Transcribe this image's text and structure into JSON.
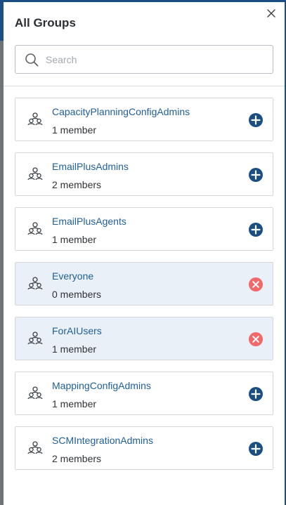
{
  "panel": {
    "title": "All Groups",
    "close_icon": "close-icon"
  },
  "search": {
    "placeholder": "Search",
    "value": "",
    "icon": "search-icon"
  },
  "colors": {
    "link": "#1f5e99",
    "add_button": "#1b4f83",
    "remove_button": "#f06a6a",
    "selected_row_bg": "#e9f0f7"
  },
  "groups": [
    {
      "name": "CapacityPlanningConfigAdmins",
      "members": "1 member",
      "selected": false,
      "action": "add"
    },
    {
      "name": "EmailPlusAdmins",
      "members": "2 members",
      "selected": false,
      "action": "add"
    },
    {
      "name": "EmailPlusAgents",
      "members": "1 member",
      "selected": false,
      "action": "add"
    },
    {
      "name": "Everyone",
      "members": "0 members",
      "selected": true,
      "action": "remove"
    },
    {
      "name": "ForAIUsers",
      "members": "1 member",
      "selected": true,
      "action": "remove"
    },
    {
      "name": "MappingConfigAdmins",
      "members": "1 member",
      "selected": false,
      "action": "add"
    },
    {
      "name": "SCMIntegrationAdmins",
      "members": "2 members",
      "selected": false,
      "action": "add"
    }
  ]
}
